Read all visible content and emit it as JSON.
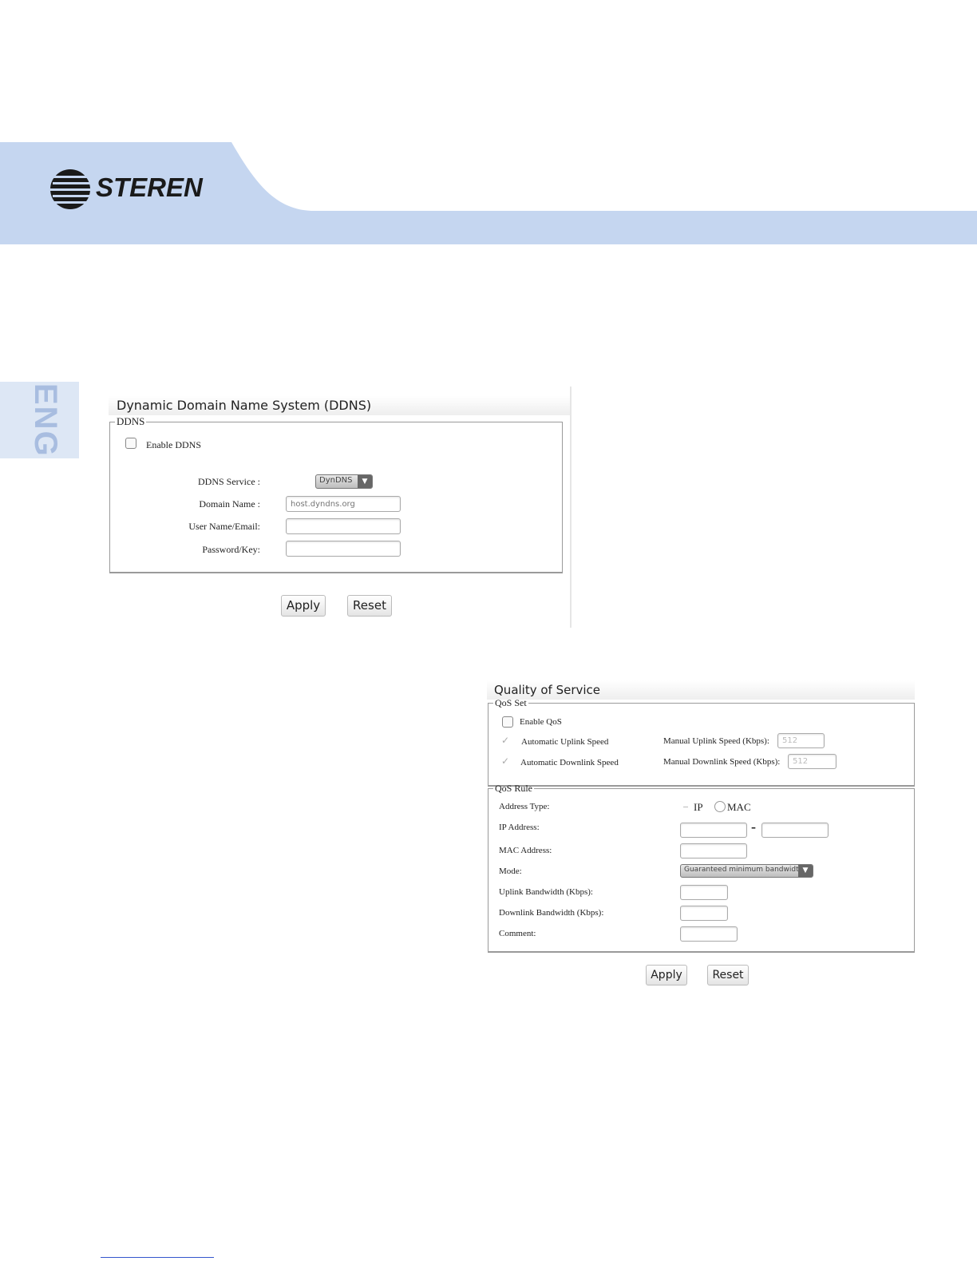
{
  "colors": {
    "band": "#c5d6f0",
    "eng_tab": "#dde7f5",
    "eng_text": "#a8bde0"
  },
  "brand": {
    "logo_text": "STEREN"
  },
  "side_tab": {
    "label": "ENG"
  },
  "ddns": {
    "title": "Dynamic Domain Name System (DDNS)",
    "group_legend": "DDNS",
    "enable_label": "Enable DDNS",
    "service_label": "DDNS Service :",
    "service_value": "DynDNS",
    "domain_label": "Domain Name :",
    "domain_placeholder": "host.dyndns.org",
    "user_label": "User Name/Email:",
    "user_value": "",
    "password_label": "Password/Key:",
    "password_value": "",
    "apply_label": "Apply",
    "reset_label": "Reset"
  },
  "qos": {
    "title": "Quality of Service",
    "set_legend": "QoS Set",
    "enable_label": "Enable QoS",
    "auto_uplink_label": "Automatic Uplink Speed",
    "auto_downlink_label": "Automatic Downlink Speed",
    "manual_uplink_label": "Manual Uplink Speed (Kbps):",
    "manual_uplink_value": "512",
    "manual_downlink_label": "Manual Downlink Speed (Kbps):",
    "manual_downlink_value": "512",
    "rule_legend": "QoS Rule",
    "address_type_label": "Address Type:",
    "address_type_options": [
      "IP",
      "MAC"
    ],
    "ip_address_label": "IP Address:",
    "ip_separator": "-",
    "mac_address_label": "MAC Address:",
    "mode_label": "Mode:",
    "mode_value": "Guaranteed minimum bandwidth",
    "uplink_bw_label": "Uplink Bandwidth (Kbps):",
    "downlink_bw_label": "Downlink Bandwidth (Kbps):",
    "comment_label": "Comment:",
    "apply_label": "Apply",
    "reset_label": "Reset"
  }
}
